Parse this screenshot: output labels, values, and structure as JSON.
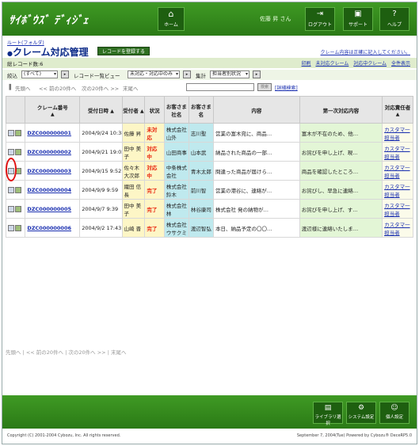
{
  "header": {
    "logo": "ｻｲﾎﾞｳｽﾞ ﾃﾞｨｼﾞｪ",
    "home_label": "ホーム",
    "user_label": "佐藤 昇 さん",
    "buttons": [
      {
        "label": "ログアウト",
        "icon": "logout-icon"
      },
      {
        "label": "サポート",
        "icon": "support-icon"
      },
      {
        "label": "ヘルプ",
        "icon": "help-icon"
      }
    ]
  },
  "breadcrumb": "ルート(フォルダ)",
  "title": "クレーム対応管理",
  "register_button": "レコードを登録する",
  "right_link": "クレーム内容は正確に記入してください。",
  "count_label": "総レコード数:6",
  "top_links": [
    "印刷",
    "未対応クレーム",
    "対応中クレーム",
    "全件表示"
  ],
  "filter": {
    "label1": "絞込",
    "sel1": "(すべて)",
    "label2": "レコード一覧ビュー",
    "sel2": "未対応・対応中のみ",
    "label3": "集計",
    "sel3": "担当者別状況"
  },
  "nav": {
    "first": "先頭へ",
    "prev": "<< 前の20件へ",
    "next": "次の20件へ >>",
    "last": "末尾へ",
    "search_btn": "検索",
    "detail_link": "[詳細検索]"
  },
  "table": {
    "headers": [
      "クレーム番号",
      "受付日時",
      "受付者",
      "状況",
      "お客さま社名",
      "お客さま名",
      "内容",
      "第一次対応内容",
      "対応責任者"
    ],
    "rows": [
      {
        "id": "DZC000000001",
        "date": "2004/9/24 10:38",
        "person": "佐藤 昇",
        "status": "未対応",
        "company": "株式会社山外",
        "name": "志川聖",
        "content": "営業の富木宛に、商品…",
        "first": "富木が不在のため、他…",
        "resp": "カスタマ一担当者"
      },
      {
        "id": "DZC000000002",
        "date": "2004/9/21 19:02",
        "person": "田中 美子",
        "status": "対応中",
        "company": "山田商事",
        "name": "山本武",
        "content": "納品された商品の一部…",
        "first": "お詫びを申し上げ、現…",
        "resp": "カスタマ一担当者"
      },
      {
        "id": "DZC000000003",
        "date": "2004/9/15 9:52",
        "person": "佐々木 大次郎",
        "status": "対応中",
        "company": "中条株式会社",
        "name": "青木太郎",
        "content": "問違った商品が届けら…",
        "first": "商品を確認したところ…",
        "resp": "カスタマ一担当者"
      },
      {
        "id": "DZC000000004",
        "date": "2004/9/9 9:59",
        "person": "織田 信長",
        "status": "完了",
        "company": "株式会社鈴木",
        "name": "前川智",
        "content": "営業の港谷に、連絡が…",
        "first": "お詫びし、早急に連絡…",
        "resp": "カスタマ一担当者"
      },
      {
        "id": "DZC000000005",
        "date": "2004/9/7 9:39",
        "person": "田中 美子",
        "status": "完了",
        "company": "株式会社林",
        "name": "林谷康司",
        "content": "株式会社 発の納物が…",
        "first": "お詫びを申し上げ、す…",
        "resp": "カスタマ一担当者"
      },
      {
        "id": "DZC000000006",
        "date": "2004/9/2 17:43",
        "person": "山崎 晋",
        "status": "完了",
        "company": "株式会社ウサクミ",
        "name": "渡辺智弘",
        "content": "本日、納品予定の〇〇…",
        "first": "渡辺様に連絡いたしま…",
        "resp": "カスタマ一担当者"
      }
    ]
  },
  "footer": {
    "buttons": [
      "ライブラリ選択",
      "システム設定",
      "個人設定"
    ],
    "copyright": "Copyright (C) 2001-2004 Cybozu, Inc. All rights reserved.",
    "date_powered": "September 7, 2004(Tue)  Powered by Cybozu® DeceRP5.0"
  },
  "colors": {
    "green": "#3f9a24",
    "status_red": "#e8220a",
    "link_blue": "#1a2fb0",
    "highlight_red": "#e01010"
  }
}
